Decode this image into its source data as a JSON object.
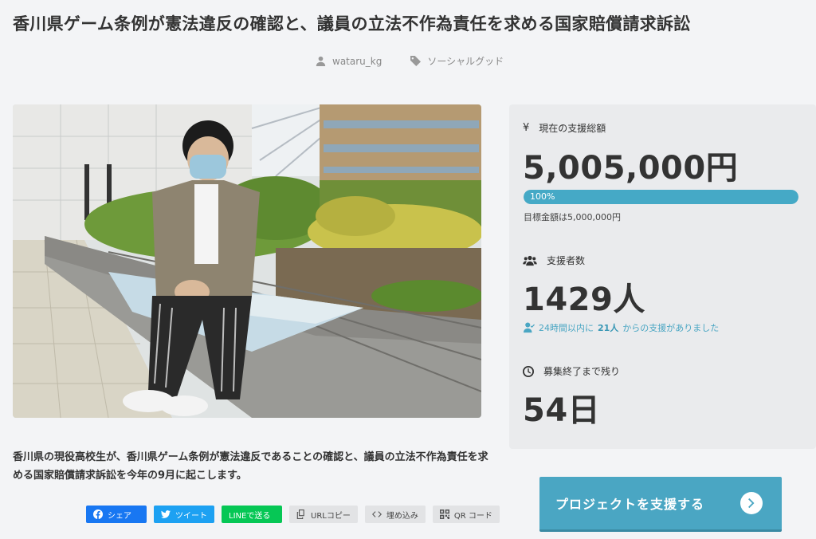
{
  "page": {
    "title": "香川県ゲーム条例が憲法違反の確認と、議員の立法不作為責任を求める国家賠償請求訴訟",
    "author": "wataru_kg",
    "category": "ソーシャルグッド"
  },
  "description": "香川県の現役高校生が、香川県ゲーム条例が憲法違反であることの確認と、議員の立法不作為責任を求める国家賠償請求訴訟を今年の9月に起こします。",
  "share": {
    "facebook": "シェア",
    "twitter": "ツイート",
    "line": "LINEで送る",
    "url_copy": "URLコピー",
    "embed": "埋め込み",
    "qr": "QR コード"
  },
  "stats": {
    "total_label": "現在の支援総額",
    "total_value": "5,005,000円",
    "progress_label": "100%",
    "progress_fraction": 1.0,
    "goal_text": "目標金額は5,000,000円",
    "supporters_label": "支援者数",
    "supporters_value": "1429人",
    "recent_prefix": "24時間以内に",
    "recent_count": "21人",
    "recent_suffix": "からの支援がありました",
    "remaining_label": "募集終了まで残り",
    "remaining_value": "54日"
  },
  "cta": {
    "label": "プロジェクトを支援する"
  },
  "colors": {
    "accent": "#4aa6c3",
    "facebook": "#1877f2",
    "twitter": "#1da1f2",
    "line": "#06c755"
  }
}
